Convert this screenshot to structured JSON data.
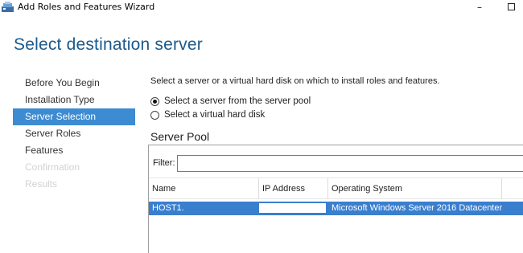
{
  "window": {
    "title": "Add Roles and Features Wizard",
    "minimize_glyph": "–"
  },
  "page": {
    "title": "Select destination server"
  },
  "nav": {
    "items": [
      {
        "label": "Before You Begin",
        "state": "normal"
      },
      {
        "label": "Installation Type",
        "state": "normal"
      },
      {
        "label": "Server Selection",
        "state": "active"
      },
      {
        "label": "Server Roles",
        "state": "normal"
      },
      {
        "label": "Features",
        "state": "normal"
      },
      {
        "label": "Confirmation",
        "state": "disabled"
      },
      {
        "label": "Results",
        "state": "disabled"
      }
    ]
  },
  "content": {
    "intro": "Select a server or a virtual hard disk on which to install roles and features.",
    "options": [
      {
        "label": "Select a server from the server pool",
        "checked": true
      },
      {
        "label": "Select a virtual hard disk",
        "checked": false
      }
    ],
    "pool_heading": "Server Pool",
    "filter": {
      "label": "Filter:",
      "value": ""
    },
    "columns": [
      "Name",
      "IP Address",
      "Operating System"
    ],
    "rows": [
      {
        "name": "HOST1.",
        "ip": "",
        "os": "Microsoft Windows Server 2016 Datacenter",
        "selected": true
      }
    ]
  },
  "colors": {
    "title_blue": "#1a5a8c",
    "nav_active": "#3d8bd1",
    "row_selected": "#3a7fce"
  }
}
